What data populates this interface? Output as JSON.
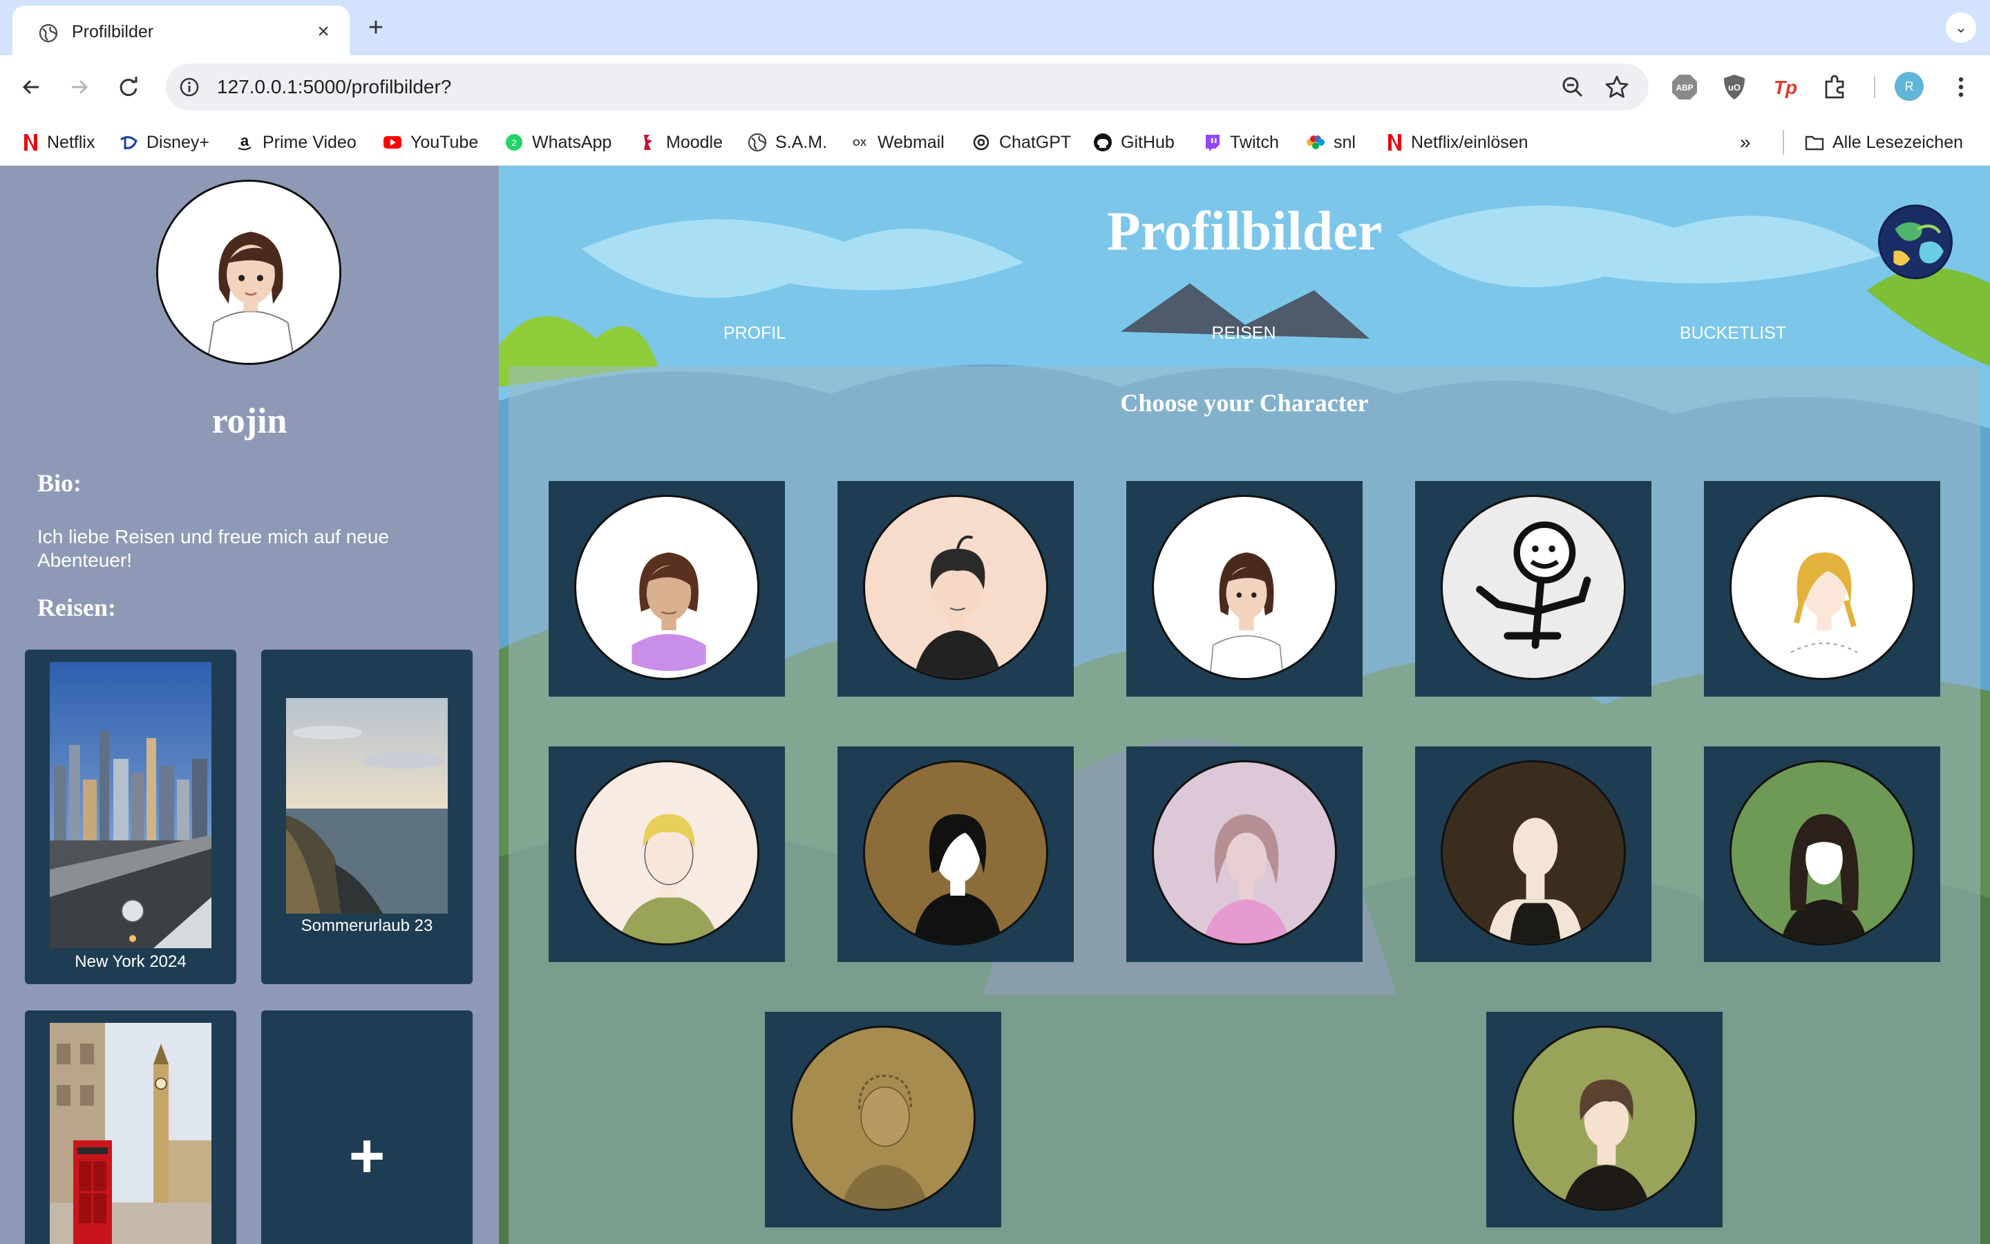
{
  "browser": {
    "tab_title": "Profilbilder",
    "url": "127.0.0.1:5000/profilbilder?",
    "bookmarks": [
      "Netflix",
      "Disney+",
      "Prime Video",
      "YouTube",
      "WhatsApp",
      "Moodle",
      "S.A.M.",
      "Webmail",
      "ChatGPT",
      "GitHub",
      "Twitch",
      "snl",
      "Netflix/einlösen"
    ],
    "all_bookmarks": "Alle Lesezeichen",
    "profile_initial": "R",
    "colors": {
      "tabstrip": "#d3e3fd",
      "omnibox": "#efeff3"
    }
  },
  "sidebar": {
    "username": "rojin",
    "bio_heading": "Bio:",
    "bio_text": "Ich liebe Reisen und freue mich auf neue Abenteuer!",
    "trips_heading": "Reisen:",
    "trips": [
      {
        "label": "New York 2024"
      },
      {
        "label": "Sommerurlaub 23"
      },
      {
        "label": ""
      }
    ],
    "add_label": "+",
    "colors": {
      "background": "#8e9ab5",
      "card": "#1e3d52"
    }
  },
  "main": {
    "title": "Profilbilder",
    "nav": [
      "PROFIL",
      "REISEN",
      "BUCKETLIST"
    ],
    "choose_title": "Choose your Character",
    "characters": [
      {
        "icon": "girl-purple-top-avatar-icon",
        "bg": "#ffffff"
      },
      {
        "icon": "boy-black-shirt-avatar-icon",
        "bg": "#f8dccb"
      },
      {
        "icon": "girl-white-top-avatar-icon",
        "bg": "#ffffff"
      },
      {
        "icon": "stick-figure-avatar-icon",
        "bg": "#ececec"
      },
      {
        "icon": "blonde-girl-avatar-icon",
        "bg": "#ffffff"
      },
      {
        "icon": "blonde-boy-green-shirt-avatar-icon",
        "bg": "#f7ebe3"
      },
      {
        "icon": "black-hair-hoodie-avatar-icon",
        "bg": "#8c6d3a"
      },
      {
        "icon": "girl-pink-top-avatar-icon",
        "bg": "#dcc8d6"
      },
      {
        "icon": "bald-boy-tank-top-avatar-icon",
        "bg": "#3b2d1e"
      },
      {
        "icon": "long-hair-girl-avatar-icon",
        "bg": "#6f9a55"
      },
      {
        "icon": "faded-boy-avatar-icon",
        "bg": "#a68c4f"
      },
      {
        "icon": "brown-hair-boy-avatar-icon",
        "bg": "#9aa35a"
      }
    ],
    "colors": {
      "card": "#1e3d52",
      "text": "#ffffff"
    }
  }
}
